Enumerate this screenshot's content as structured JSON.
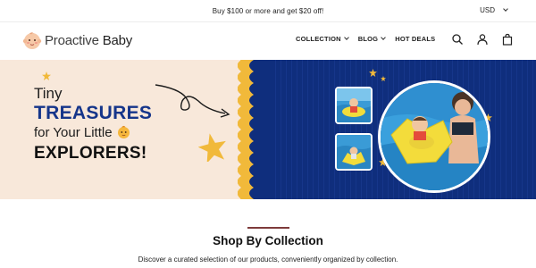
{
  "announcement": {
    "text": "Buy $100 or more and get $20 off!",
    "currency": "USD"
  },
  "header": {
    "logo_word1": "Proactive",
    "logo_word2": "Baby",
    "nav": [
      {
        "label": "COLLECTION",
        "has_dropdown": true
      },
      {
        "label": "BLOG",
        "has_dropdown": true
      },
      {
        "label": "HOT DEALS",
        "has_dropdown": false
      }
    ],
    "icons": [
      "search-icon",
      "account-icon",
      "cart-icon"
    ]
  },
  "hero": {
    "line1": "Tiny",
    "line2": "TREASURES",
    "line3": "for Your Little",
    "line4": "EXPLORERS!",
    "colors": {
      "cream": "#f8e8da",
      "navy": "#0f2e7d",
      "gold": "#f1b93a"
    }
  },
  "collection": {
    "title": "Shop By Collection",
    "subtitle": "Discover a curated selection of our products, conveniently organized by collection."
  }
}
